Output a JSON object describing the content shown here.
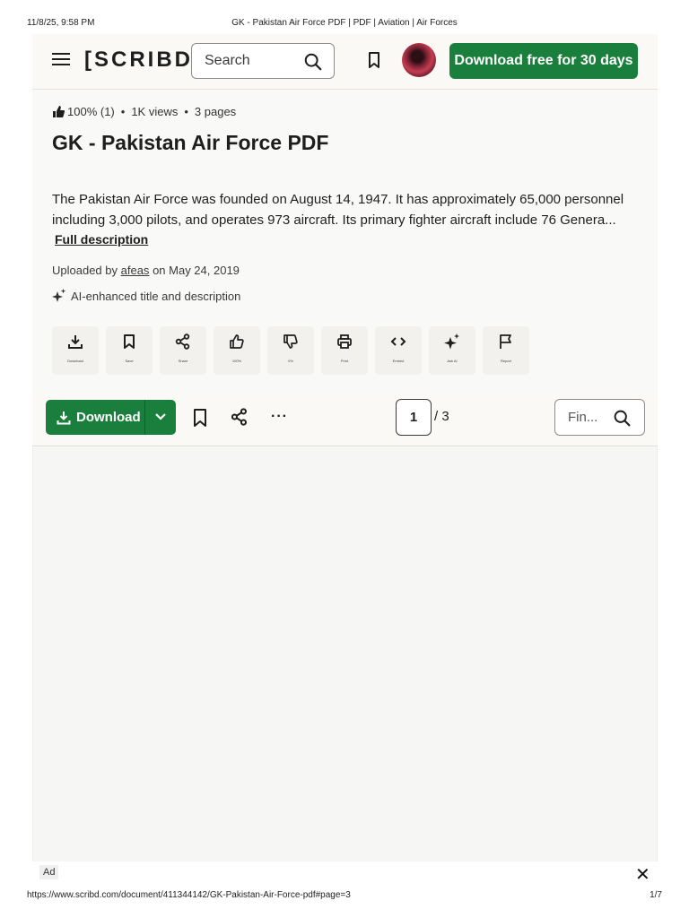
{
  "print": {
    "timestamp": "11/8/25, 9:58 PM",
    "tab_title": "GK - Pakistan Air Force PDF | PDF | Aviation | Air Forces",
    "url": "https://www.scribd.com/document/411344142/GK-Pakistan-Air-Force-pdf#page=3",
    "page_counter": "1/7"
  },
  "header": {
    "logo": "[SCRIBD]",
    "search_placeholder": "Search",
    "cta": "Download free for 30 days"
  },
  "doc": {
    "rating": "100% (1)",
    "views": "1K views",
    "pages": "3 pages",
    "title": "GK - Pakistan Air Force PDF",
    "description_line1": "The Pakistan Air Force was founded on August 14, 1947. It has approximately 65,000 personnel",
    "description_line2": "including 3,000 pilots, and operates 973 aircraft. Its primary fighter aircraft include 76 Genera...",
    "full_description": "Full description",
    "uploaded_prefix": "Uploaded by",
    "uploader": "afeas",
    "uploaded_suffix": "on May 24, 2019",
    "ai_note": "AI-enhanced title and description"
  },
  "actions": [
    {
      "label": "Download",
      "icon": "download-icon"
    },
    {
      "label": "Save",
      "icon": "bookmark-icon"
    },
    {
      "label": "Share",
      "icon": "share-icon"
    },
    {
      "label": "100%",
      "icon": "thumbs-up-icon"
    },
    {
      "label": "0%",
      "icon": "thumbs-down-icon"
    },
    {
      "label": "Print",
      "icon": "print-icon"
    },
    {
      "label": "Embed",
      "icon": "embed-icon"
    },
    {
      "label": "Ask AI",
      "icon": "sparkle-icon"
    },
    {
      "label": "Report",
      "icon": "flag-icon"
    }
  ],
  "toolbar": {
    "download_label": "Download",
    "more": "···",
    "current_page": "1",
    "total_pages": "/ 3",
    "find_placeholder": "Fin..."
  },
  "ad": {
    "label": "Ad",
    "close": "✕"
  },
  "colors": {
    "brand_green": "#1a7f3c",
    "page_bg": "#f9f9f7"
  }
}
